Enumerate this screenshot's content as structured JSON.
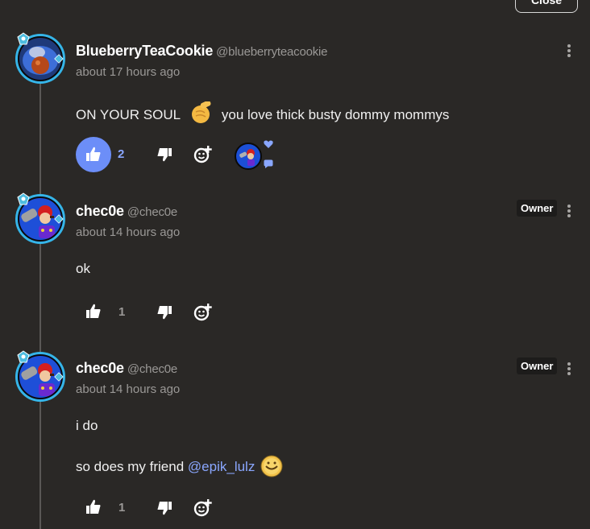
{
  "top_button": {
    "label": "Close"
  },
  "comments": [
    {
      "display_name": "BlueberryTeaCookie",
      "handle": "@blueberryteacookie",
      "timestamp": "about 17 hours ago",
      "body": [
        "ON YOUR SOUL",
        "you love thick busty dommy mommys"
      ],
      "inline_emojis": [
        "pointing-hand-emoji"
      ],
      "likes": "2",
      "liked": true,
      "has_reply_preview": true
    },
    {
      "display_name": "chec0e",
      "handle": "@chec0e",
      "timestamp": "about 14 hours ago",
      "owner_badge": "Owner",
      "body": [
        "ok"
      ],
      "likes": "1",
      "liked": false
    },
    {
      "display_name": "chec0e",
      "handle": "@chec0e",
      "timestamp": "about 14 hours ago",
      "owner_badge": "Owner",
      "body": [
        "i do",
        "so does my friend",
        "@epik_lulz"
      ],
      "inline_emojis": [
        "smile-emoji"
      ],
      "likes": "1",
      "liked": false
    }
  ],
  "icons": [
    "thumbs-up-icon",
    "thumbs-down-icon",
    "add-reaction-icon",
    "kebab-menu-icon",
    "rank-badge-icon"
  ],
  "colors": {
    "background": "#2a2826",
    "accent": "#6c8ef8",
    "mention": "#8aa7ff",
    "avatar_ring": "#35b5e8"
  }
}
